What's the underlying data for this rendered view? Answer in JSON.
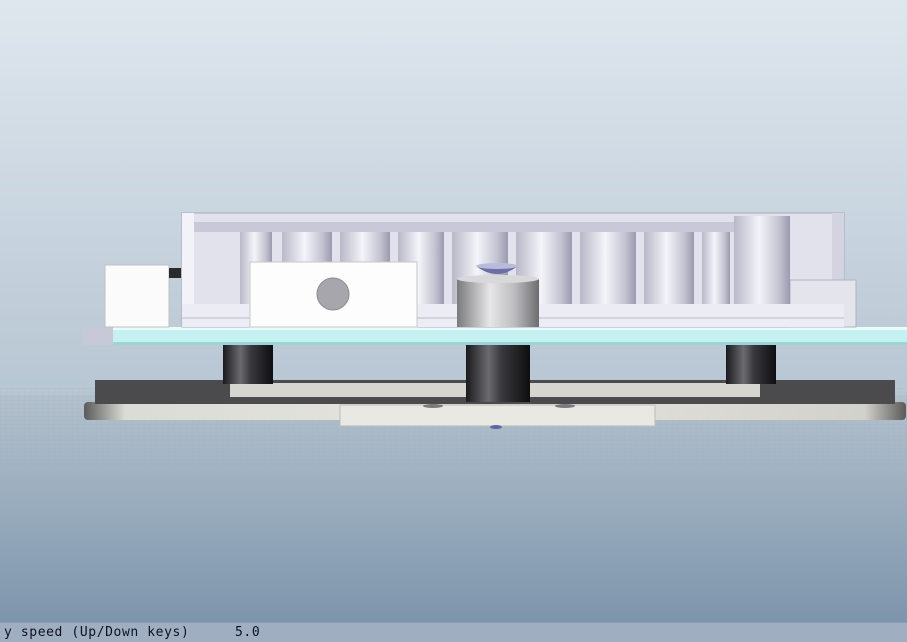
{
  "viewer": {
    "scene": "3d-cad-model",
    "colors": {
      "sky_top": "#dde6ee",
      "sky_bottom": "#b9c8d5",
      "floor_top": "#aebdca",
      "floor_bottom": "#7f97ae",
      "pcb": "#c9f2f3",
      "base_plate": "#e3e2dc",
      "status_bar": "#a0aec2"
    }
  },
  "status_bar": {
    "label": "y speed (Up/Down keys)",
    "value": "5.0"
  }
}
